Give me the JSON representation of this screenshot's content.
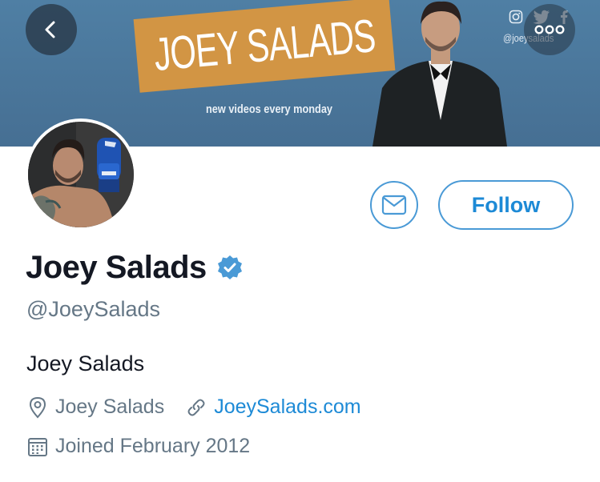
{
  "banner": {
    "sign_text": "JOEY SALADS",
    "tagline": "new videos every monday",
    "social_handle": "@joeysalads",
    "social_icons": [
      "instagram-icon",
      "twitter-icon",
      "facebook-icon"
    ]
  },
  "nav": {
    "back_icon": "chevron-left-icon",
    "more_icon": "more-dots-icon"
  },
  "actions": {
    "message_icon": "envelope-icon",
    "follow_label": "Follow"
  },
  "profile": {
    "name": "Joey Salads",
    "verified": true,
    "handle": "@JoeySalads",
    "bio": "Joey Salads",
    "location": "Joey Salads",
    "website": "JoeySalads.com",
    "joined": "Joined February 2012"
  },
  "colors": {
    "accent": "#1d8ad6",
    "verified_badge": "#4a9ad6",
    "secondary_text": "#657786",
    "banner_bg": "#4f7fa4",
    "sign_bg": "#d29544"
  }
}
